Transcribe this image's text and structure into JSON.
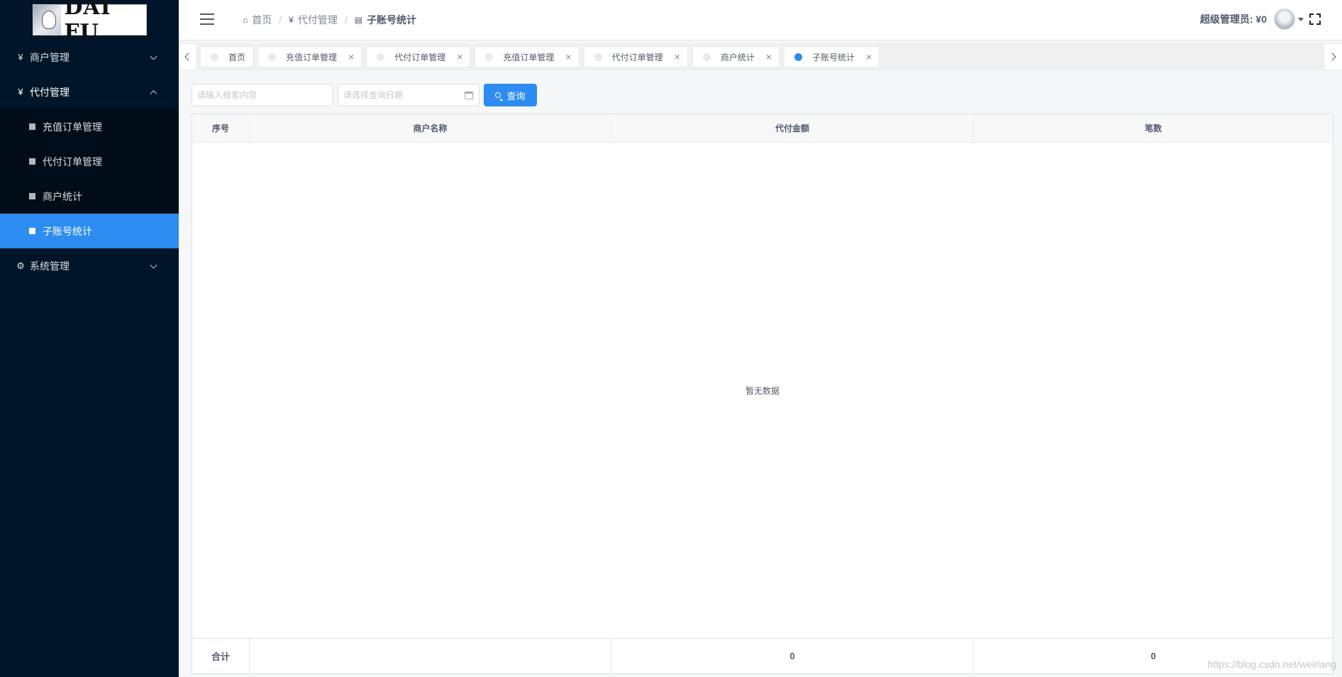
{
  "logo": {
    "text": "DAI FU"
  },
  "sidebar": {
    "items": [
      {
        "label": "商户管理",
        "icon": "¥"
      },
      {
        "label": "代付管理",
        "icon": "¥",
        "open": true,
        "children": [
          {
            "label": "充值订单管理"
          },
          {
            "label": "代付订单管理"
          },
          {
            "label": "商户统计"
          },
          {
            "label": "子账号统计",
            "active": true
          }
        ]
      },
      {
        "label": "系统管理",
        "icon": "gear-icon"
      }
    ]
  },
  "header": {
    "breadcrumb": [
      {
        "label": "首页",
        "icon": "home-icon"
      },
      {
        "label": "代付管理",
        "icon": "yen-icon"
      },
      {
        "label": "子账号统计",
        "icon": "list-icon"
      }
    ],
    "user_label": "超级管理员: ¥0"
  },
  "tabs": [
    {
      "label": "首页",
      "closable": false
    },
    {
      "label": "充值订单管理",
      "closable": true
    },
    {
      "label": "代付订单管理",
      "closable": true
    },
    {
      "label": "充值订单管理",
      "closable": true
    },
    {
      "label": "代付订单管理",
      "closable": true
    },
    {
      "label": "商户统计",
      "closable": true
    },
    {
      "label": "子账号统计",
      "closable": true,
      "active": true
    }
  ],
  "toolbar": {
    "search_placeholder": "请输入搜索内容",
    "date_placeholder": "请选择查询日期",
    "query_label": "查询"
  },
  "table": {
    "columns": [
      "序号",
      "商户名称",
      "代付金额",
      "笔数"
    ],
    "empty_text": "暂无数据",
    "footer": [
      "合计",
      "",
      "0",
      "0"
    ]
  },
  "watermark": "https://blog.csdn.net/weirlang",
  "colors": {
    "primary": "#2d8cf0",
    "sidebar_bg": "#001529",
    "submenu_bg": "#000c17"
  }
}
